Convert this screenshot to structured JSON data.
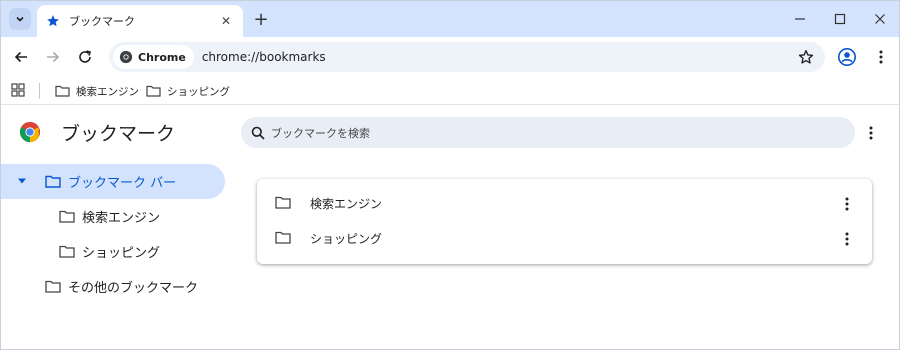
{
  "tab": {
    "title": "ブックマーク",
    "close_glyph": "✕",
    "favicon": "star-icon"
  },
  "newtab_glyph": "+",
  "window_controls": {
    "minimize": "—",
    "maximize": "☐",
    "close": "✕"
  },
  "omnibox": {
    "chip_label": "Chrome",
    "url": "chrome://bookmarks"
  },
  "bookmarks_bar": {
    "items": [
      {
        "label": "検索エンジン"
      },
      {
        "label": "ショッピング"
      }
    ]
  },
  "page": {
    "title": "ブックマーク",
    "search_placeholder": "ブックマークを検索"
  },
  "sidebar": {
    "items": [
      {
        "label": "ブックマーク バー",
        "selected": true,
        "expanded": true
      },
      {
        "label": "検索エンジン"
      },
      {
        "label": "ショッピング"
      },
      {
        "label": "その他のブックマーク"
      }
    ]
  },
  "list": {
    "rows": [
      {
        "label": "検索エンジン"
      },
      {
        "label": "ショッピング"
      }
    ]
  },
  "colors": {
    "accent": "#0b57d0",
    "tabstrip": "#d3e3fd",
    "selected": "#d3e3fd",
    "omnibox": "#eef2f9"
  }
}
